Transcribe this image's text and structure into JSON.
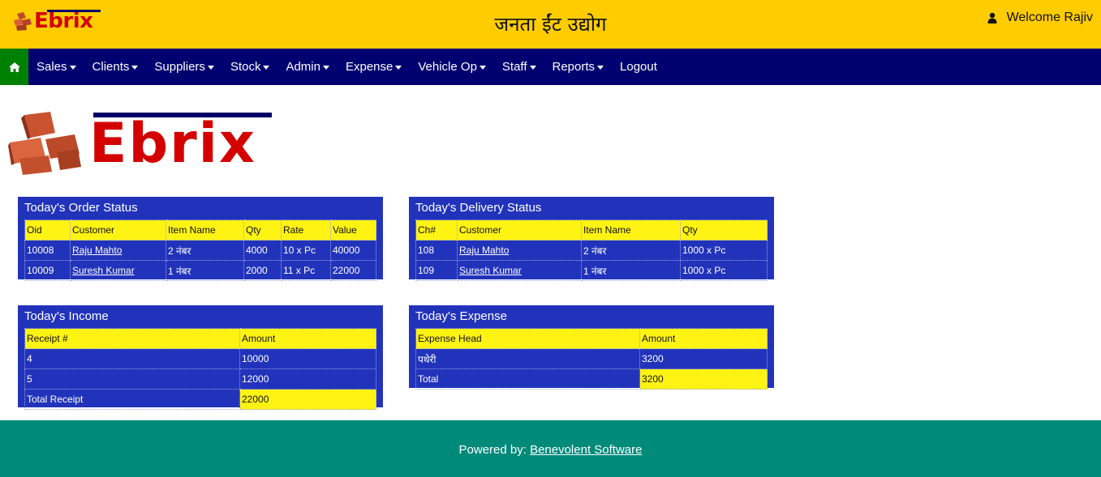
{
  "header": {
    "brand": "Ebrix",
    "site_title": "जनता ईंट उद्योग",
    "welcome": "Welcome Rajiv"
  },
  "colors": {
    "header_bg": "#ffcc00",
    "nav_bg": "#000070",
    "home_bg": "#008000",
    "panel_bg": "#2233bb",
    "table_header_bg": "#fff314",
    "footer_bg": "#008a7a",
    "logo_red": "#d40000"
  },
  "nav": {
    "home_icon": "home-icon",
    "items": [
      {
        "label": "Sales",
        "dropdown": true
      },
      {
        "label": "Clients",
        "dropdown": true
      },
      {
        "label": "Suppliers",
        "dropdown": true
      },
      {
        "label": "Stock",
        "dropdown": true
      },
      {
        "label": "Admin",
        "dropdown": true
      },
      {
        "label": "Expense",
        "dropdown": true
      },
      {
        "label": "Vehicle Op",
        "dropdown": true
      },
      {
        "label": "Staff",
        "dropdown": true
      },
      {
        "label": "Reports",
        "dropdown": true
      },
      {
        "label": "Logout",
        "dropdown": false
      }
    ]
  },
  "logo": {
    "text": "Ebrix"
  },
  "order_status": {
    "title": "Today's Order Status",
    "columns": [
      "Oid",
      "Customer",
      "Item Name",
      "Qty",
      "Rate",
      "Value"
    ],
    "rows": [
      [
        "10008",
        "Raju Mahto",
        "2 नंबर",
        "4000",
        "10 x Pc",
        "40000"
      ],
      [
        "10009",
        "Suresh Kumar",
        "1 नंबर",
        "2000",
        "11 x Pc",
        "22000"
      ]
    ]
  },
  "delivery_status": {
    "title": "Today's Delivery Status",
    "columns": [
      "Ch#",
      "Customer",
      "Item Name",
      "Qty"
    ],
    "rows": [
      [
        "108",
        "Raju Mahto",
        "2 नंबर",
        "1000 x Pc"
      ],
      [
        "109",
        "Suresh Kumar",
        "1 नंबर",
        "1000 x Pc"
      ]
    ]
  },
  "income": {
    "title": "Today's Income",
    "columns": [
      "Receipt #",
      "Amount"
    ],
    "rows": [
      [
        "4",
        "10000"
      ],
      [
        "5",
        "12000"
      ]
    ],
    "total_label": "Total Receipt",
    "total_value": "22000"
  },
  "expense": {
    "title": "Today's Expense",
    "columns": [
      "Expense Head",
      "Amount"
    ],
    "rows": [
      [
        "पथेरी",
        "3200"
      ]
    ],
    "total_label": "Total",
    "total_value": "3200"
  },
  "footer": {
    "prefix": "Powered by: ",
    "link": "Benevolent Software"
  }
}
